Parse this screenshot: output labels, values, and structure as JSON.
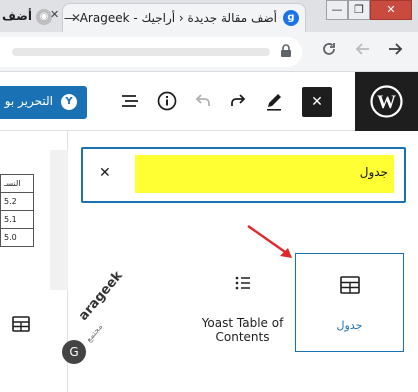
{
  "browser": {
    "active_tab": {
      "title": "أضف مقالة جديدة ‹ أراجيك - Arageek —",
      "favicon": "g",
      "close": "✕"
    },
    "left_tab": {
      "title": "أضف",
      "close": "✕"
    },
    "window_buttons": {
      "minimize": "—",
      "maximize": "❐",
      "close": "✕"
    },
    "nav": {
      "back_icon": "arrow-right-icon",
      "forward_icon": "arrow-left-icon",
      "reload_icon": "reload-icon",
      "lock_icon": "lock-icon"
    }
  },
  "editor": {
    "update_button": {
      "label": "التحرير بو",
      "icon_text": "Y"
    },
    "close_label": "✕",
    "toolbar_icons": [
      "pencil-icon",
      "redo-icon",
      "undo-icon",
      "info-icon",
      "list-view-icon"
    ]
  },
  "canvas": {
    "table_header": "النسـ",
    "table_rows": [
      "5.2",
      "5.1",
      "5.0"
    ],
    "watermark": {
      "brand": "arageek",
      "sub": "مجتمع",
      "logo": "G"
    }
  },
  "inserter": {
    "search_value": "جدول",
    "clear_label": "✕",
    "blocks": [
      {
        "label": "Yoast Table of Contents",
        "icon": "yoast-toc-icon",
        "selected": false
      },
      {
        "label": "جدول",
        "icon": "table-icon",
        "selected": true
      }
    ]
  },
  "colors": {
    "accent": "#1a72b5",
    "highlight": "#ffff33",
    "dark": "#1e1e1e",
    "arrow": "#e0282a"
  }
}
